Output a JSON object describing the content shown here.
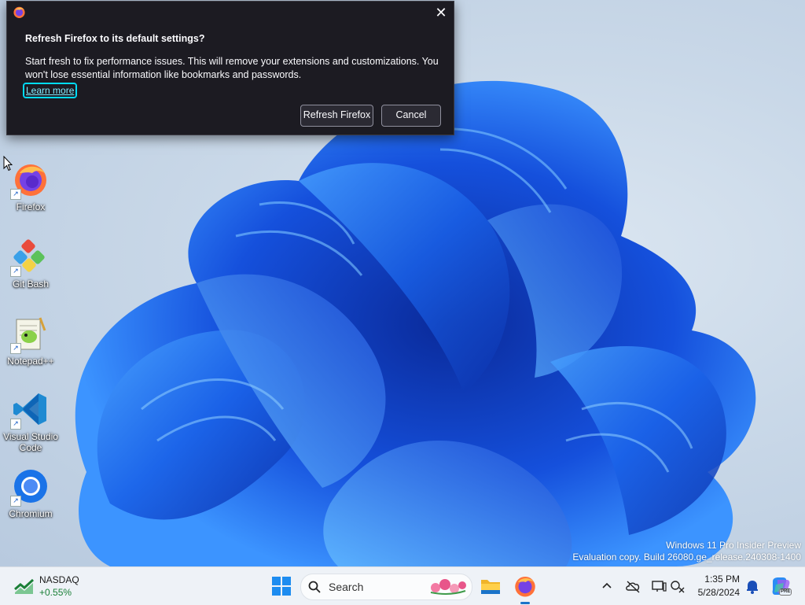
{
  "dialog": {
    "title": "Refresh Firefox to its default settings?",
    "body": "Start fresh to fix performance issues. This will remove your extensions and customizations. You won't lose essential information like bookmarks and passwords.",
    "link": "Learn more",
    "primary_button": "Refresh Firefox",
    "secondary_button": "Cancel",
    "close_icon": "close-icon"
  },
  "desktop": {
    "icons": [
      {
        "label": "Firefox",
        "icon": "firefox-icon"
      },
      {
        "label": "Git Bash",
        "icon": "git-bash-icon"
      },
      {
        "label": "Notepad++",
        "icon": "notepad-plus-plus-icon"
      },
      {
        "label": "Visual Studio Code",
        "label_line1": "Visual Studio",
        "label_line2": "Code",
        "icon": "vscode-icon"
      },
      {
        "label": "Chromium",
        "icon": "chromium-icon"
      }
    ],
    "watermark": {
      "line1": "Windows 11 Pro Insider Preview",
      "line2": "Evaluation copy. Build 26080.ge_release.240308-1400"
    }
  },
  "taskbar": {
    "stock": {
      "name": "NASDAQ",
      "change": "+0.55%"
    },
    "search_label": "Search",
    "clock": {
      "time": "1:35 PM",
      "date": "5/28/2024"
    },
    "copilot_badge": "PRE",
    "tray_icons": [
      "chevron-up-icon",
      "cloud-offline-icon",
      "display-icon",
      "network-icon",
      "bell-icon"
    ]
  },
  "colors": {
    "dialog_bg": "#1c1b22",
    "link": "#80ebff",
    "taskbar_bg": "#eef2f7",
    "accent": "#1a73c9"
  }
}
